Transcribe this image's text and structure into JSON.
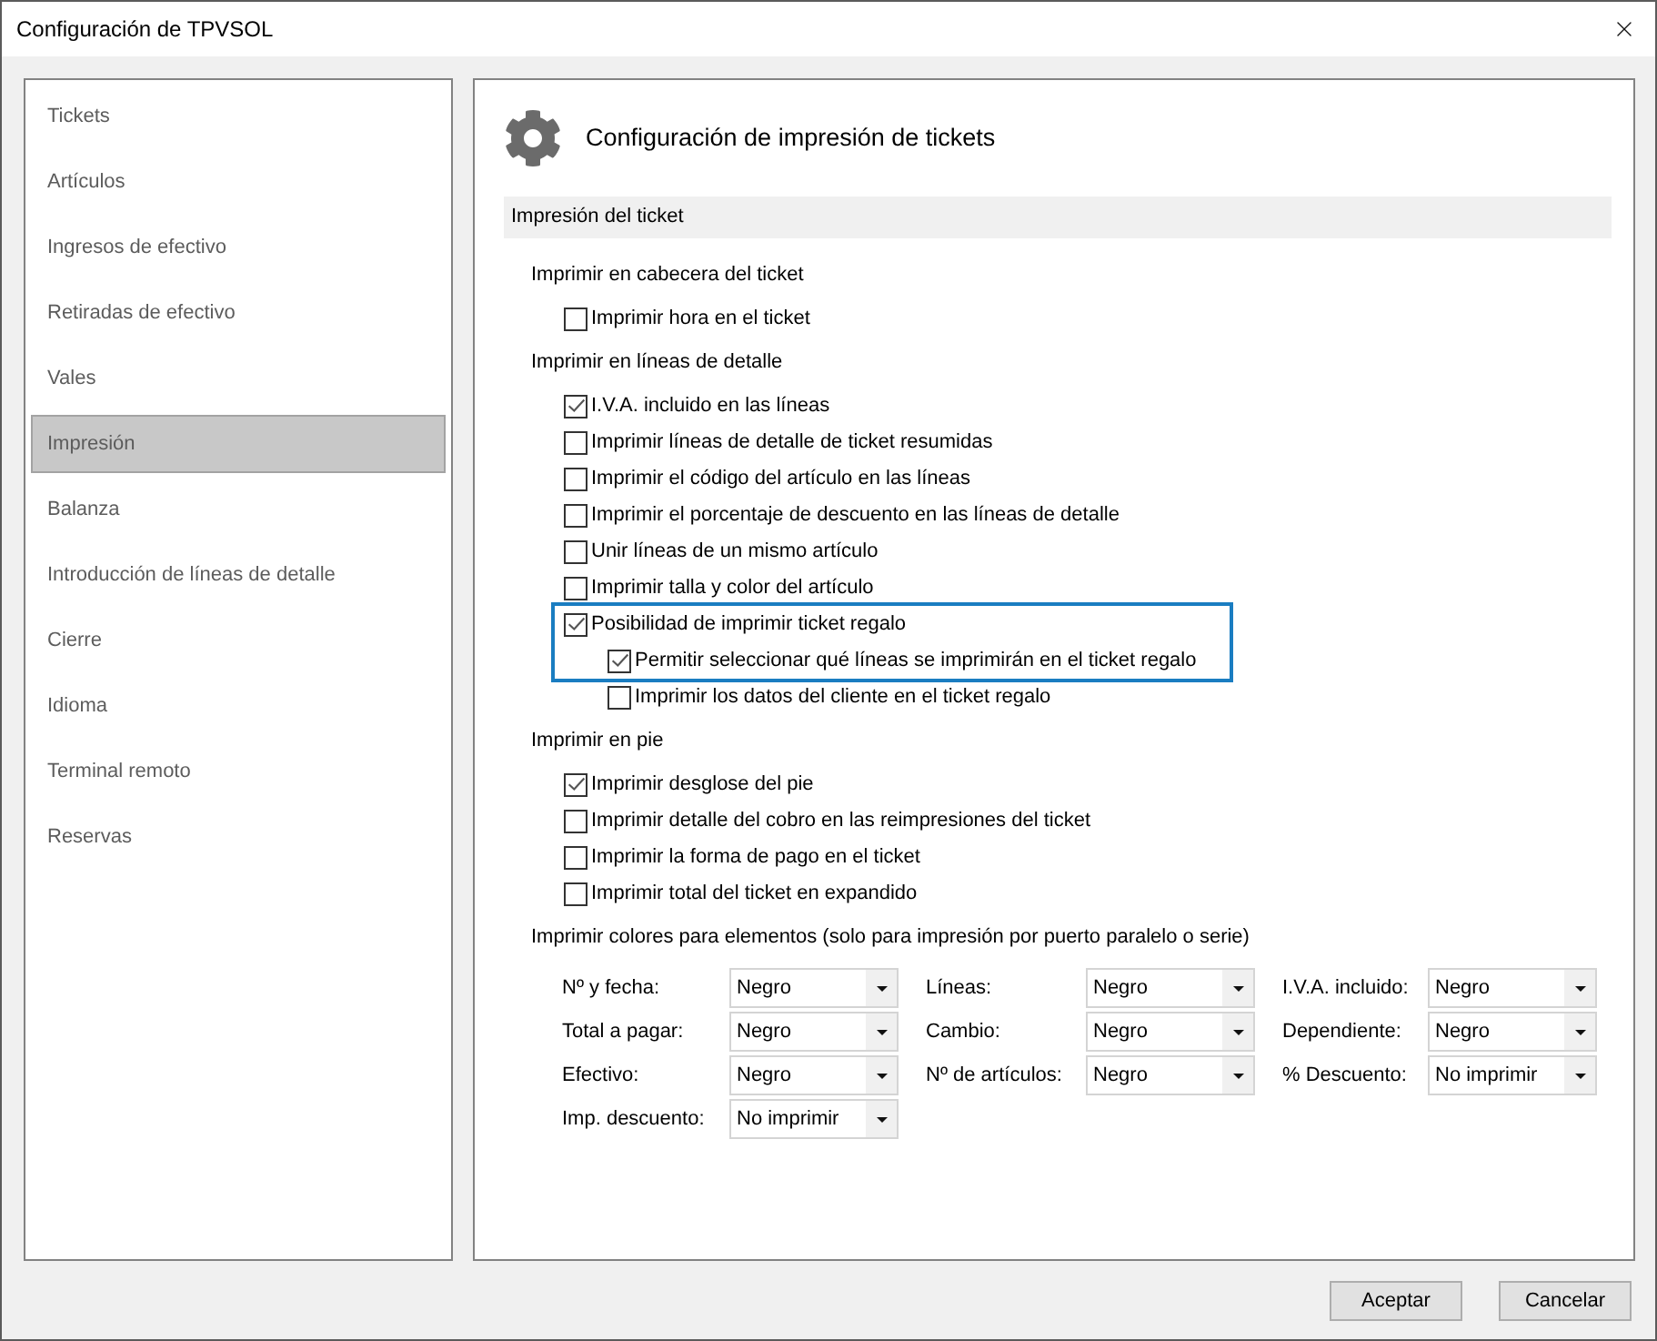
{
  "window": {
    "title": "Configuración de TPVSOL"
  },
  "sidebar": {
    "items": [
      {
        "label": "Tickets",
        "selected": false
      },
      {
        "label": "Artículos",
        "selected": false
      },
      {
        "label": "Ingresos de efectivo",
        "selected": false
      },
      {
        "label": "Retiradas de efectivo",
        "selected": false
      },
      {
        "label": "Vales",
        "selected": false
      },
      {
        "label": "Impresión",
        "selected": true
      },
      {
        "label": "Balanza",
        "selected": false
      },
      {
        "label": "Introducción de líneas de detalle",
        "selected": false
      },
      {
        "label": "Cierre",
        "selected": false
      },
      {
        "label": "Idioma",
        "selected": false
      },
      {
        "label": "Terminal remoto",
        "selected": false
      },
      {
        "label": "Reservas",
        "selected": false
      }
    ]
  },
  "page": {
    "title": "Configuración de impresión de tickets"
  },
  "section": {
    "title": "Impresión del ticket"
  },
  "groups": [
    {
      "heading": "Imprimir en cabecera del ticket",
      "options": [
        {
          "label": "Imprimir hora en el ticket",
          "checked": false,
          "highlighted": false
        }
      ]
    },
    {
      "heading": "Imprimir en líneas de detalle",
      "options": [
        {
          "label": "I.V.A. incluido en las líneas",
          "checked": true,
          "highlighted": false
        },
        {
          "label": "Imprimir líneas de detalle de ticket resumidas",
          "checked": false,
          "highlighted": false
        },
        {
          "label": "Imprimir el código del artículo en las líneas",
          "checked": false,
          "highlighted": false
        },
        {
          "label": "Imprimir el porcentaje de descuento en las líneas de detalle",
          "checked": false,
          "highlighted": false
        },
        {
          "label": "Unir líneas de un mismo artículo",
          "checked": false,
          "highlighted": false
        },
        {
          "label": "Imprimir talla y color del artículo",
          "checked": false,
          "highlighted": false
        },
        {
          "label": "Posibilidad de imprimir ticket regalo",
          "checked": true,
          "highlighted": true,
          "children": [
            {
              "label": "Permitir seleccionar qué líneas se imprimirán en el ticket regalo",
              "checked": true,
              "highlighted": true
            },
            {
              "label": "Imprimir los datos del cliente en el ticket regalo",
              "checked": false,
              "highlighted": false
            }
          ]
        }
      ]
    },
    {
      "heading": "Imprimir en pie",
      "options": [
        {
          "label": "Imprimir desglose del pie",
          "checked": true,
          "highlighted": false
        },
        {
          "label": "Imprimir detalle del cobro en las reimpresiones del ticket",
          "checked": false,
          "highlighted": false
        },
        {
          "label": "Imprimir la forma de pago en el ticket",
          "checked": false,
          "highlighted": false
        },
        {
          "label": "Imprimir total del ticket en expandido",
          "checked": false,
          "highlighted": false
        }
      ]
    }
  ],
  "colors": {
    "heading": "Imprimir colores para elementos (solo para impresión por puerto paralelo o serie)",
    "fields": [
      {
        "label": "Nº y fecha:",
        "value": "Negro"
      },
      {
        "label": "Líneas:",
        "value": "Negro"
      },
      {
        "label": "I.V.A. incluido:",
        "value": "Negro"
      },
      {
        "label": "Total a pagar:",
        "value": "Negro"
      },
      {
        "label": "Cambio:",
        "value": "Negro"
      },
      {
        "label": "Dependiente:",
        "value": "Negro"
      },
      {
        "label": "Efectivo:",
        "value": "Negro"
      },
      {
        "label": "Nº de artículos:",
        "value": "Negro"
      },
      {
        "label": "% Descuento:",
        "value": "No imprimir"
      },
      {
        "label": "Imp. descuento:",
        "value": "No imprimir"
      }
    ]
  },
  "buttons": [
    {
      "label": "Aceptar"
    },
    {
      "label": "Cancelar"
    }
  ]
}
